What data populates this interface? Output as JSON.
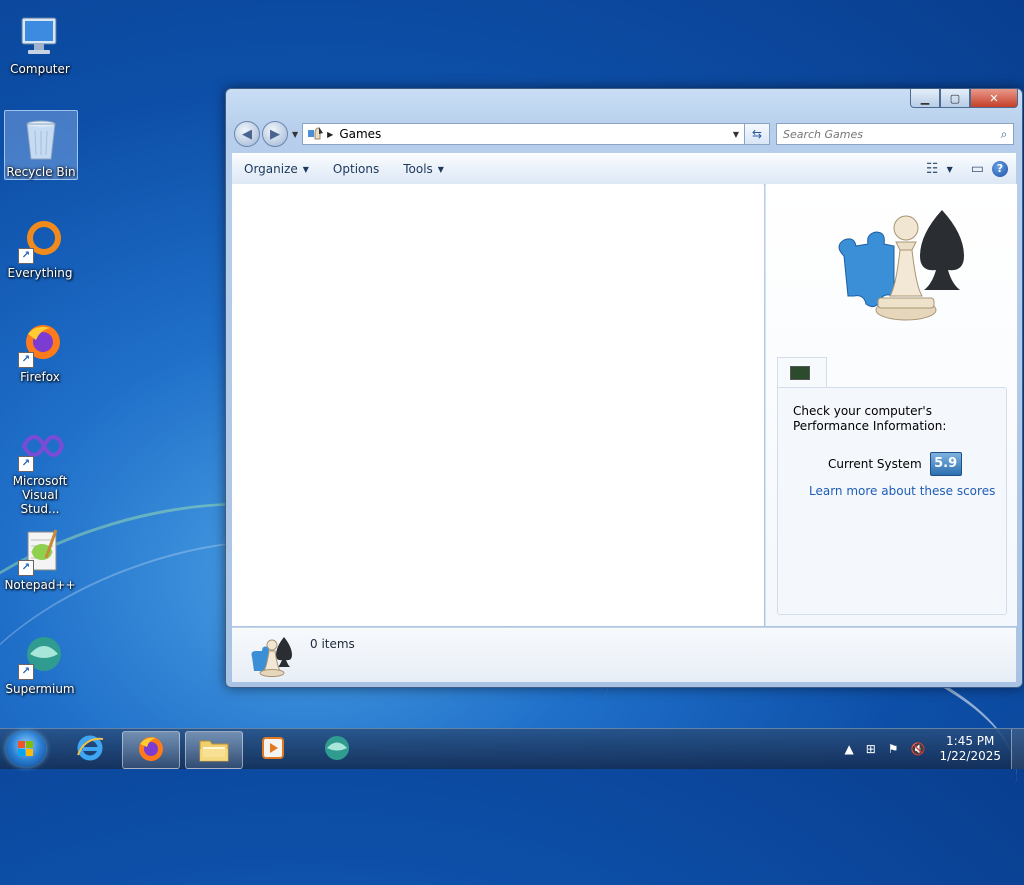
{
  "desktop": {
    "icons": [
      {
        "label": "Computer"
      },
      {
        "label": "Recycle Bin"
      },
      {
        "label": "Everything"
      },
      {
        "label": "Firefox"
      },
      {
        "label": "Microsoft Visual Stud..."
      },
      {
        "label": "Notepad++"
      },
      {
        "label": "Supermium"
      }
    ]
  },
  "window": {
    "address": {
      "current": "Games"
    },
    "search": {
      "placeholder": "Search Games"
    },
    "toolbar": {
      "organize": "Organize",
      "options": "Options",
      "tools": "Tools"
    },
    "preview": {
      "perf_title": "Check your computer's Performance Information:",
      "current_label": "Current System",
      "score": "5.9",
      "link": "Learn more about these scores"
    },
    "status": {
      "count": "0 items"
    }
  },
  "taskbar": {
    "clock_time": "1:45 PM",
    "clock_date": "1/22/2025"
  },
  "colors": {
    "accent": "#1e5eb5",
    "taskbar": "#1c3f70"
  }
}
